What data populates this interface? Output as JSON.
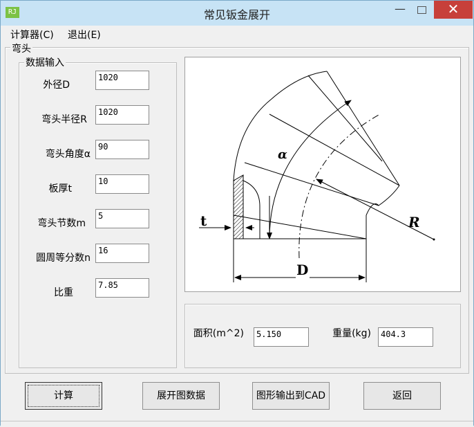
{
  "window": {
    "title": "常见钣金展开",
    "app_icon_text": "RJ",
    "minimize_symbol": "—",
    "close_symbol": "✕"
  },
  "menu": {
    "items": [
      "计算器(C)",
      "退出(E)"
    ]
  },
  "tab_group_label": "弯头",
  "input_group": {
    "label": "数据输入",
    "fields": [
      {
        "label": "外径D",
        "value": "1020"
      },
      {
        "label": "弯头半径R",
        "value": "1020"
      },
      {
        "label": "弯头角度α",
        "value": "90"
      },
      {
        "label": "板厚t",
        "value": "10"
      },
      {
        "label": "弯头节数m",
        "value": "5"
      },
      {
        "label": "圆周等分数n",
        "value": "16"
      },
      {
        "label": "比重",
        "value": "7.85"
      }
    ]
  },
  "diagram": {
    "labels": {
      "alpha": "α",
      "R": "R",
      "t": "t",
      "D": "D"
    }
  },
  "results": {
    "area_label": "面积(m^2)",
    "area_value": "5.150",
    "weight_label": "重量(kg)",
    "weight_value": "404.3"
  },
  "buttons": {
    "calculate": "计算",
    "unfold_data": "展开图数据",
    "export_cad": "图形输出到CAD",
    "back": "返回"
  }
}
